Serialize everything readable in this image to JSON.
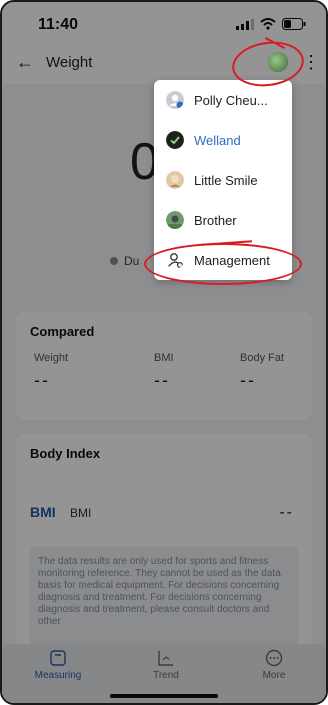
{
  "status": {
    "time": "11:40"
  },
  "header": {
    "title": "Weight"
  },
  "main": {
    "value": "0",
    "source_label": "Du"
  },
  "compared": {
    "title": "Compared",
    "metrics": [
      {
        "label": "Weight",
        "value": "--"
      },
      {
        "label": "BMI",
        "value": "--"
      },
      {
        "label": "Body Fat",
        "value": "--"
      }
    ]
  },
  "body_index": {
    "title": "Body Index",
    "bmi_brand": "BMI",
    "bmi_label": "BMI",
    "bmi_value": "--",
    "disclaimer": "The data results are only used for sports and fitness monitoring reference. They cannot be used as the data basis for medical equipment. For decisions concerning diagnosis and treatment. For decisions concerning diagnosis and treatment, please consult doctors and other"
  },
  "menu": {
    "items": [
      {
        "label": "Polly Cheu...",
        "icon": "profile-avatar-icon"
      },
      {
        "label": "Welland",
        "icon": "check-avatar-icon",
        "selected": true
      },
      {
        "label": "Little Smile",
        "icon": "child-avatar-icon"
      },
      {
        "label": "Brother",
        "icon": "brother-avatar-icon"
      },
      {
        "label": "Management",
        "icon": "user-settings-icon"
      }
    ]
  },
  "tabs": [
    {
      "label": "Measuring",
      "icon": "scale-icon",
      "active": true
    },
    {
      "label": "Trend",
      "icon": "chart-icon"
    },
    {
      "label": "More",
      "icon": "more-icon"
    }
  ],
  "colors": {
    "accent": "#2f6fbf",
    "annotation": "#d91c24"
  }
}
